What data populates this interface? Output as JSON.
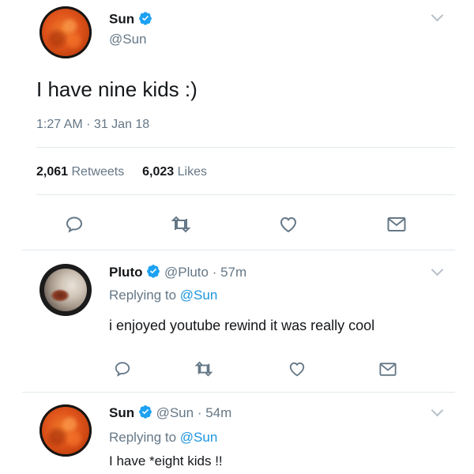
{
  "tweet": {
    "name": "Sun",
    "handle": "@Sun",
    "text": "I have nine kids :)",
    "timestamp": "1:27 AM · 31 Jan 18",
    "retweets_count": "2,061",
    "retweets_label": "Retweets",
    "likes_count": "6,023",
    "likes_label": "Likes"
  },
  "reply1": {
    "name": "Pluto",
    "handle": "@Pluto",
    "time": "· 57m",
    "replying_prefix": "Replying to",
    "replying_handle": "@Sun",
    "text": "i enjoyed youtube rewind it was really cool"
  },
  "reply2": {
    "name": "Sun",
    "handle": "@Sun",
    "time": "· 54m",
    "replying_prefix": "Replying to",
    "replying_handle": "@Sun",
    "text": "I have *eight kids !!"
  },
  "icons": {
    "verified_color": "#1da1f2",
    "action_color": "#657786"
  }
}
